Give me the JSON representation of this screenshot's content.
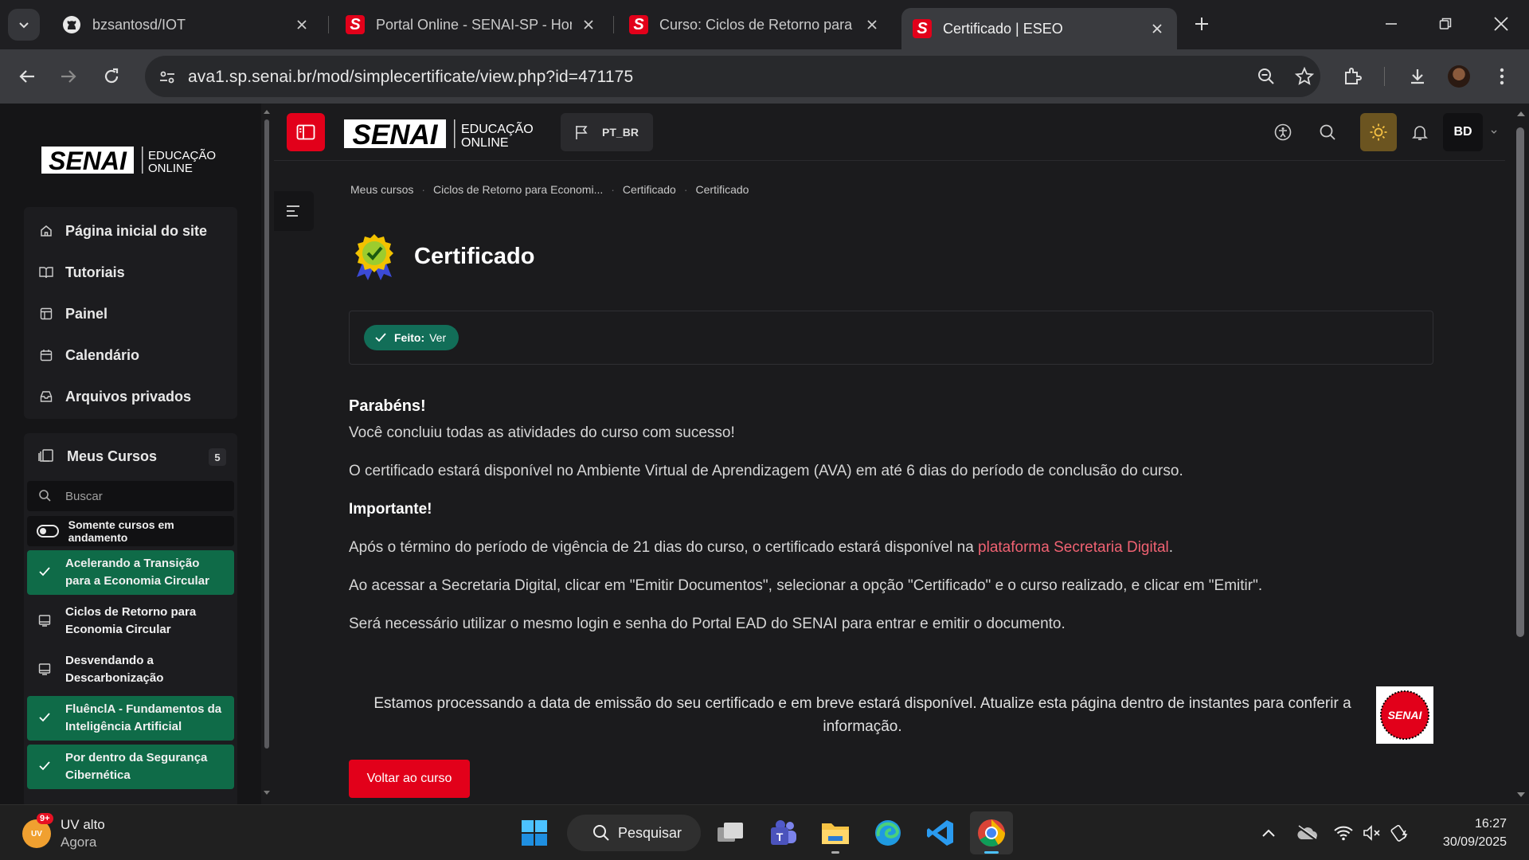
{
  "browser": {
    "tabs": [
      {
        "title": "bzsantosd/IOT",
        "favicon": "github-icon",
        "active": false
      },
      {
        "title": "Portal Online - SENAI-SP - Hom",
        "favicon": "senai-icon",
        "active": false
      },
      {
        "title": "Curso: Ciclos de Retorno para E",
        "favicon": "senai-icon",
        "active": false
      },
      {
        "title": "Certificado | ESEO",
        "favicon": "senai-icon",
        "active": true
      }
    ],
    "url": "ava1.sp.senai.br/mod/simplecertificate/view.php?id=471175"
  },
  "brand": {
    "logo_text": "SENAI",
    "logo_sub_1": "EDUCAÇÃO",
    "logo_sub_2": "ONLINE",
    "primary_color": "#e2001a",
    "success_color": "#0f6b48"
  },
  "header": {
    "language": "PT_BR",
    "user_initials": "BD"
  },
  "sidebar": {
    "nav": [
      {
        "label": "Página inicial do site",
        "icon": "home-icon"
      },
      {
        "label": "Tutoriais",
        "icon": "book-icon"
      },
      {
        "label": "Painel",
        "icon": "dashboard-icon"
      },
      {
        "label": "Calendário",
        "icon": "calendar-icon"
      },
      {
        "label": "Arquivos privados",
        "icon": "archive-icon"
      }
    ],
    "my_courses": {
      "label": "Meus Cursos",
      "count": "5",
      "search_placeholder": "Buscar",
      "toggle_label": "Somente cursos em andamento",
      "courses": [
        {
          "name": "Acelerando a Transição para a Economia Circular",
          "completed": true
        },
        {
          "name": "Ciclos de Retorno para Economia Circular",
          "completed": false
        },
        {
          "name": "Desvendando a Descarbonização",
          "completed": false
        },
        {
          "name": "FluênclA - Fundamentos da Inteligência Artificial",
          "completed": true
        },
        {
          "name": "Por dentro da Segurança Cibernética",
          "completed": true
        }
      ]
    }
  },
  "main": {
    "breadcrumb": [
      "Meus cursos",
      "Ciclos de Retorno para Economi...",
      "Certificado",
      "Certificado"
    ],
    "title": "Certificado",
    "completion": {
      "label": "Feito:",
      "value": "Ver"
    },
    "congrats": "Parabéns!",
    "p1": "Você concluiu todas as atividades do curso com sucesso!",
    "p2": "O certificado estará disponível no Ambiente Virtual de Aprendizagem (AVA) em até 6 dias do período de conclusão do curso.",
    "important": "Importante!",
    "p3_before": "Após o término do período de vigência de 21 dias do curso, o certificado estará disponível na ",
    "p3_link": "plataforma Secretaria Digital",
    "p3_after": ".",
    "p4": "Ao acessar a Secretaria Digital, clicar em \"Emitir Documentos\", selecionar a opção \"Certificado\" e o curso realizado, e clicar em \"Emitir\".",
    "p5": "Será necessário utilizar o mesmo login e senha do Portal EAD do SENAI para entrar e emitir o documento.",
    "processing": "Estamos processando a data de emissão do seu certificado e em breve estará disponível. Atualize esta página dentro de instantes para conferir a informação.",
    "badge_text": "SENAI",
    "back_button": "Voltar ao curso"
  },
  "taskbar": {
    "weather_title": "UV alto",
    "weather_sub": "Agora",
    "weather_icon_text": "UV",
    "notification_count": "9+",
    "search_label": "Pesquisar",
    "time": "16:27",
    "date": "30/09/2025"
  }
}
